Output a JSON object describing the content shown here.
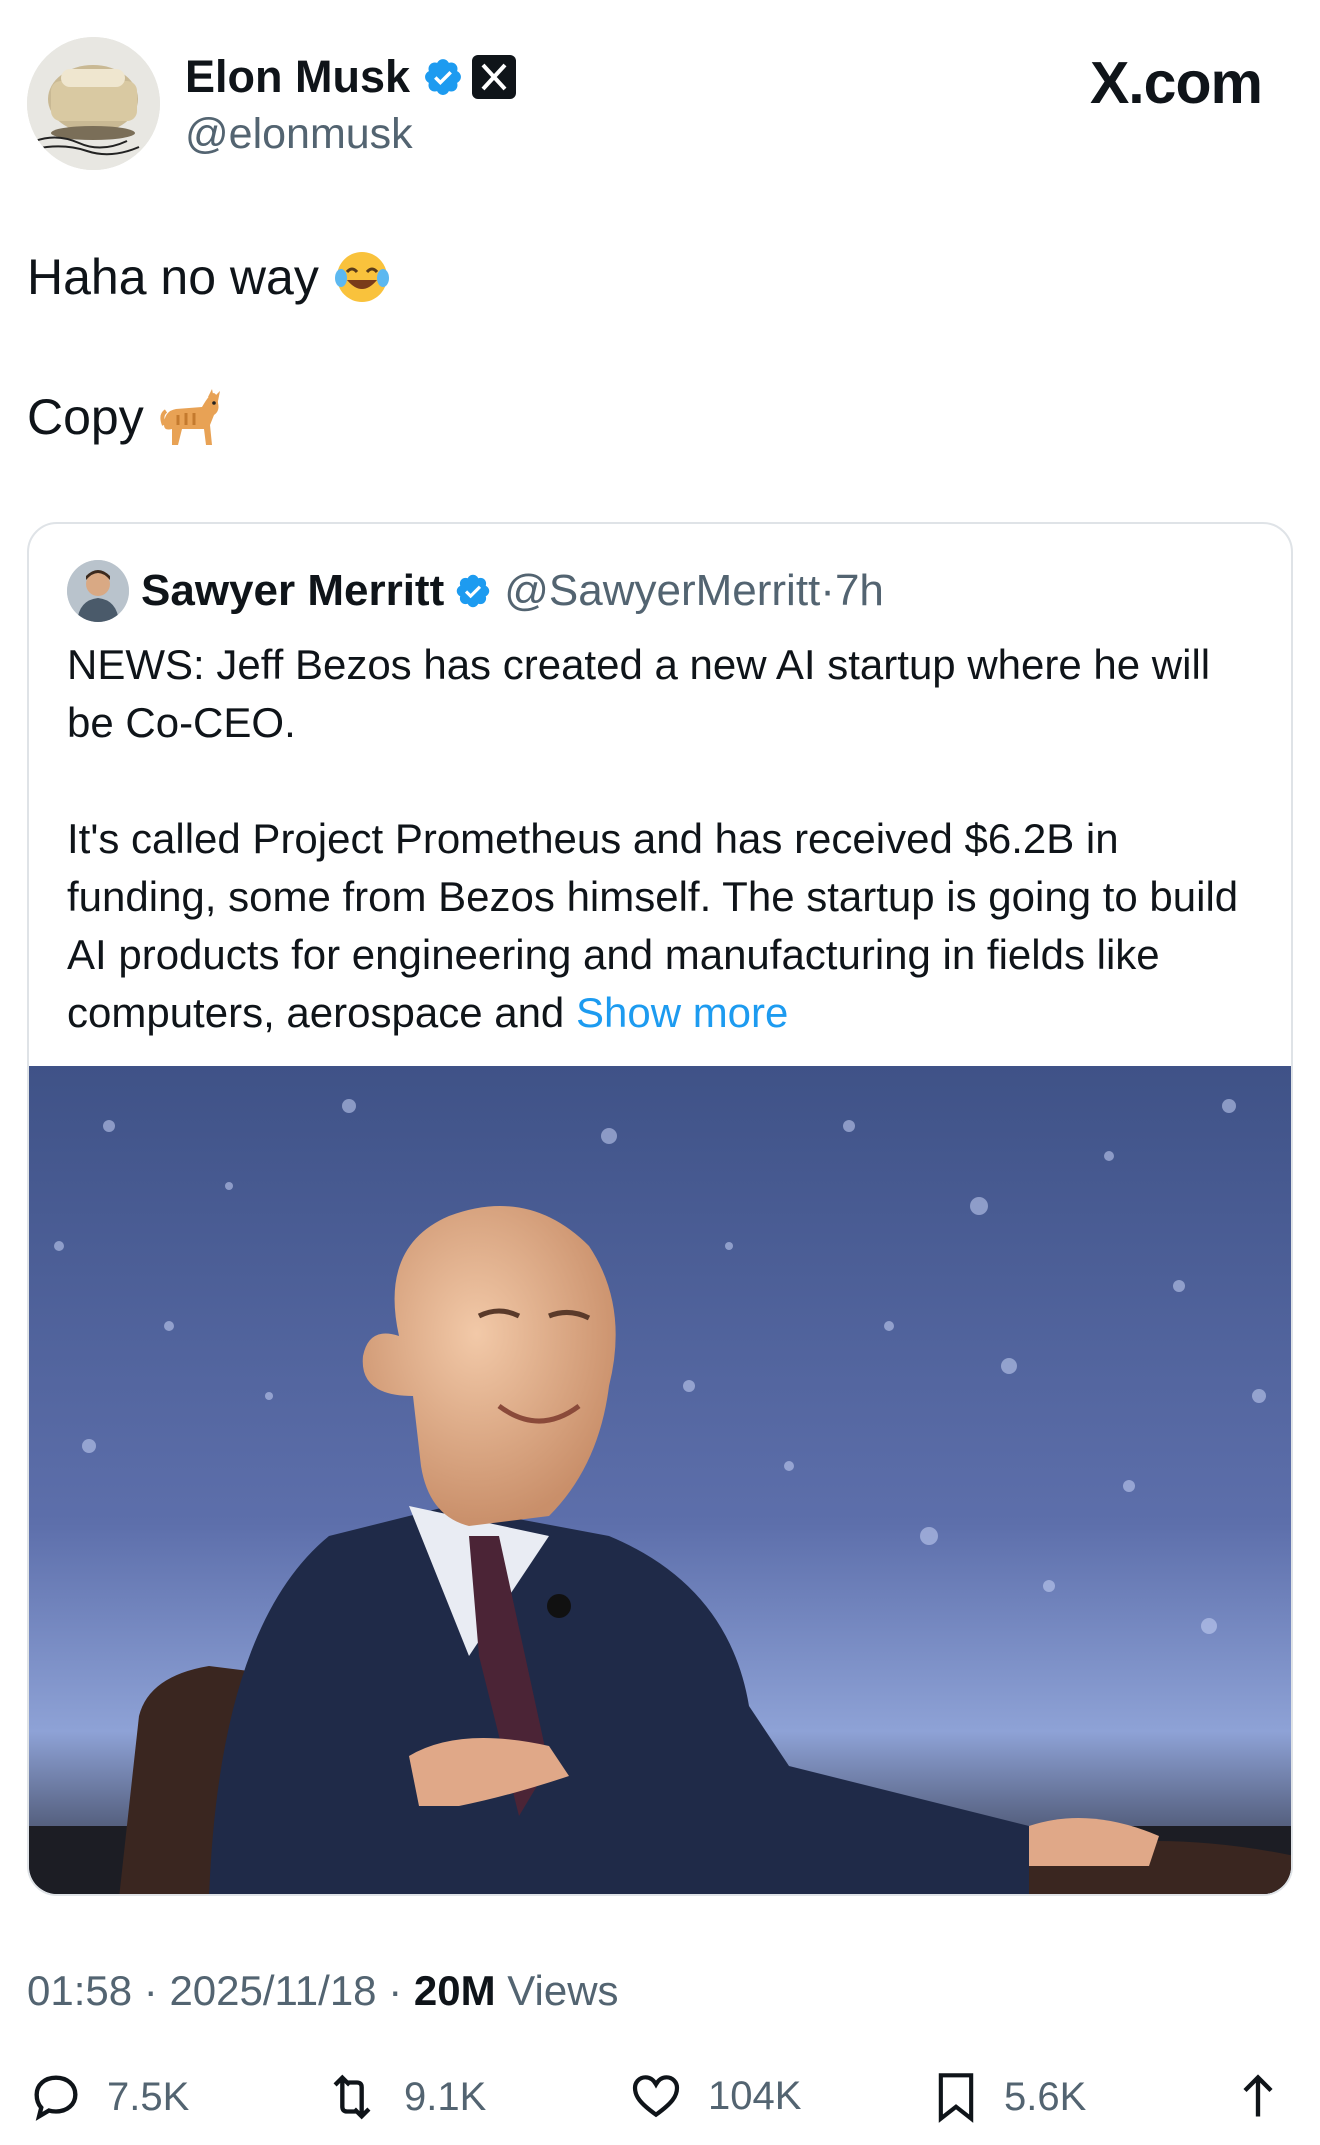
{
  "author": {
    "display_name": "Elon Musk",
    "handle": "@elonmusk",
    "verified_badge_color": "#1d9bf0",
    "affiliate_badge_icon": "x-logo-icon"
  },
  "brand": "X.com",
  "tweet": {
    "lines": [
      "Haha no way",
      "Copy"
    ],
    "emojis": [
      "tears-of-joy-emoji",
      "cat-emoji"
    ]
  },
  "quote": {
    "name": "Sawyer Merritt",
    "handle": "@SawyerMerritt",
    "separator": "·",
    "time": "7h",
    "paragraph1": "NEWS: Jeff Bezos has created a new AI startup where he will be Co-CEO.",
    "paragraph2": "It's called Project Prometheus and has received $6.2B in funding, some from Bezos himself. The startup is going to build AI products for engineering and manufacturing in fields like computers, aerospace and",
    "show_more": "Show more",
    "image_subject": "photo-bald-man-in-suit-seated-in-leather-chair-against-starry-blue-background"
  },
  "meta": {
    "time": "01:58",
    "dot": "·",
    "date": "2025/11/18",
    "views_count": "20M",
    "views_label": "Views"
  },
  "actions": {
    "replies": "7.5K",
    "reposts": "9.1K",
    "likes": "104K",
    "bookmarks": "5.6K"
  },
  "colors": {
    "link": "#1d9bf0",
    "secondary_text": "#536471",
    "primary_text": "#0f1419"
  }
}
